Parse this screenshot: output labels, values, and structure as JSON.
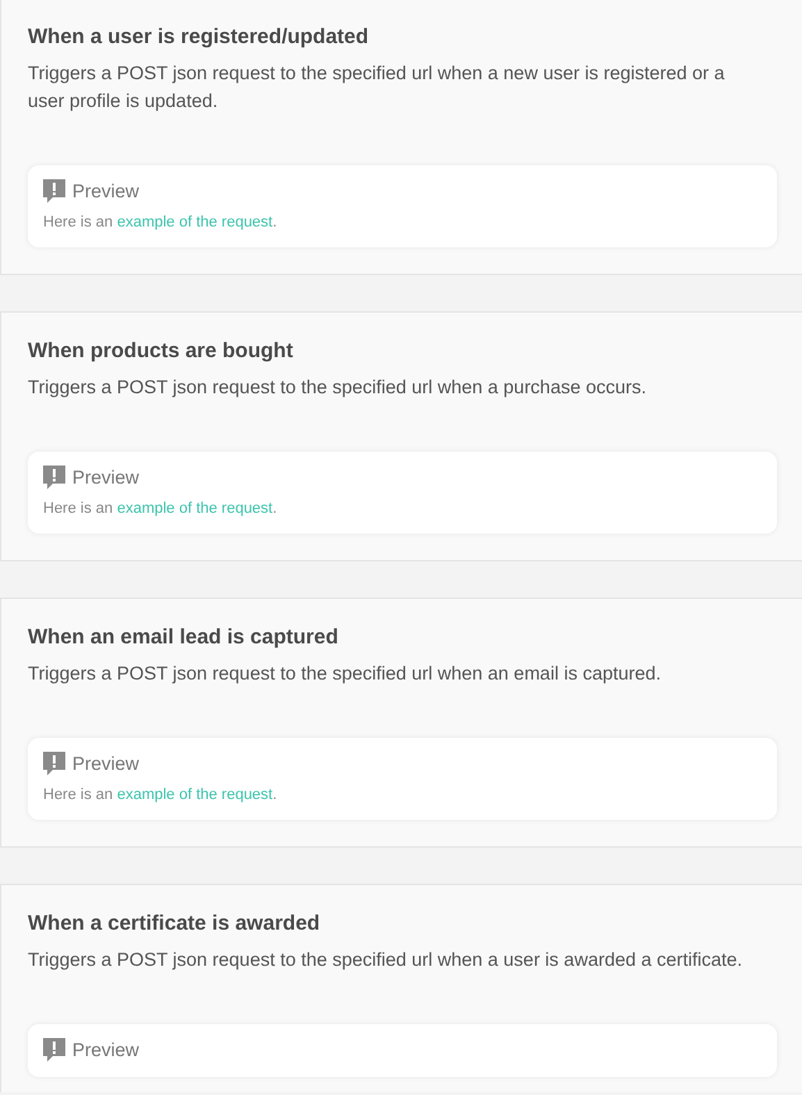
{
  "sections": [
    {
      "title": "When a user is registered/updated",
      "description": "Triggers a POST json request to the specified url when a new user is registered or a user profile is updated.",
      "preview": {
        "label": "Preview",
        "note_prefix": "Here is an",
        "link": "example of the request",
        "note_suffix": "."
      }
    },
    {
      "title": "When products are bought",
      "description": "Triggers a POST json request to the specified url when a purchase occurs.",
      "preview": {
        "label": "Preview",
        "note_prefix": "Here is an",
        "link": "example of the request",
        "note_suffix": "."
      }
    },
    {
      "title": "When an email lead is captured",
      "description": "Triggers a POST json request to the specified url when an email is captured.",
      "preview": {
        "label": "Preview",
        "note_prefix": "Here is an",
        "link": "example of the request",
        "note_suffix": "."
      }
    },
    {
      "title": "When a certificate is awarded",
      "description": "Triggers a POST json request to the specified url when a user is awarded a certificate.",
      "preview": {
        "label": "Preview"
      }
    }
  ]
}
